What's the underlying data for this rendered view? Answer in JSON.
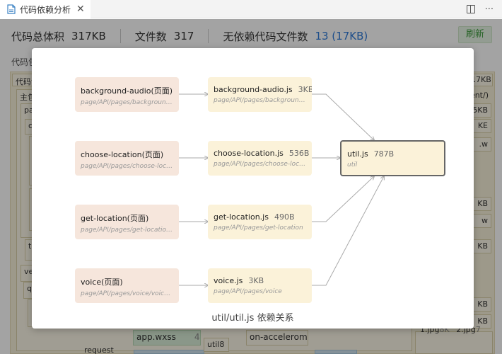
{
  "tab": {
    "title": "代码依赖分析",
    "close": "✕"
  },
  "tab_actions": {
    "more": "···"
  },
  "stats": {
    "total_label": "代码总体积",
    "total_value": "317KB",
    "files_label": "文件数",
    "files_value": "317",
    "nodep_label": "无依赖代码文件数",
    "nodep_value": "13 (17KB)"
  },
  "refresh_label": "刷新",
  "section_title": "代码包",
  "treemap": {
    "code_package": "代码包",
    "code_size": "317KB",
    "main_package": "主包",
    "main_size": "ent/)",
    "pages": "pages",
    "pages_size": "5KB",
    "r1": "co",
    "r1_size": "KE",
    "r2": "n",
    "r3": "l",
    "r4": "ta",
    "r5": "ve",
    "r6": "qu",
    "r7": "l",
    "w1": ".w",
    "w2": "w",
    "k1": "KB",
    "k2": "KB",
    "k3": "KB",
    "k4": "KB",
    "request": "request",
    "appwxss": "app.wxss",
    "appwxss_size": "4KB",
    "util8": "util8",
    "onaccel": "on-accelerome",
    "jpg1": "1.jpg",
    "jpg1_size": "8K",
    "jpg2": "2.jpg",
    "jpg2_size": "7K"
  },
  "modal": {
    "caption": "util/util.js 依赖关系",
    "pages": [
      {
        "title": "background-audio(页面)",
        "path": "page/API/pages/background-audio/background-audio.json"
      },
      {
        "title": "choose-location(页面)",
        "path": "page/API/pages/choose-location/choose-location.json"
      },
      {
        "title": "get-location(页面)",
        "path": "page/API/pages/get-location/get-location.json"
      },
      {
        "title": "voice(页面)",
        "path": "page/API/pages/voice/voice.json"
      }
    ],
    "files": [
      {
        "title": "background-audio.js",
        "size": "3KB",
        "path": "page/API/pages/background-audio/background-audio"
      },
      {
        "title": "choose-location.js",
        "size": "536B",
        "path": "page/API/pages/choose-location"
      },
      {
        "title": "get-location.js",
        "size": "490B",
        "path": "page/API/pages/get-location"
      },
      {
        "title": "voice.js",
        "size": "3KB",
        "path": "page/API/pages/voice"
      }
    ],
    "target": {
      "title": "util.js",
      "size": "787B",
      "path": "util"
    }
  },
  "colors": {
    "accent_blue": "#2f7bd8",
    "refresh_green": "#3a9a3a",
    "page_node": "#f6e6dc",
    "file_node": "#fbf2d9"
  }
}
